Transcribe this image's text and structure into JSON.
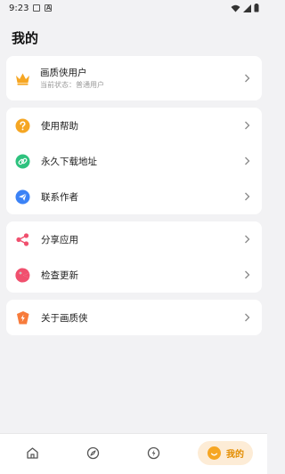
{
  "status_bar": {
    "time": "9:23"
  },
  "page": {
    "title": "我的"
  },
  "vip": {
    "title": "画质侠用户",
    "subtitle": "当前状态：普通用户",
    "icon": "crown-icon"
  },
  "menu_group_1": [
    {
      "label": "使用帮助",
      "icon": "help-icon",
      "color": "#f5a623"
    },
    {
      "label": "永久下载地址",
      "icon": "link-icon",
      "color": "#2ec27e"
    },
    {
      "label": "联系作者",
      "icon": "send-icon",
      "color": "#3b82f6"
    }
  ],
  "menu_group_2": [
    {
      "label": "分享应用",
      "icon": "share-icon",
      "color": "#f0506e"
    },
    {
      "label": "检查更新",
      "icon": "update-icon",
      "color": "#f0506e"
    }
  ],
  "menu_group_3": [
    {
      "label": "关于画质侠",
      "icon": "about-icon",
      "color": "#f77b3b"
    }
  ],
  "bottom_nav": {
    "items": [
      "home-icon",
      "compass-icon",
      "bolt-icon"
    ],
    "active_label": "我的",
    "active_icon": "smile-icon"
  },
  "colors": {
    "accent": "#f6a623",
    "accent_text": "#e38d00",
    "background": "#f2f2f4"
  }
}
